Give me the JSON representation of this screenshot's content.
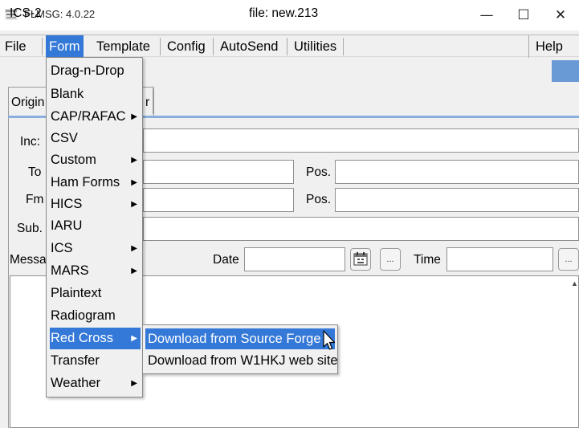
{
  "window": {
    "title": "FLMSG: 4.0.22",
    "controls": {
      "minimize": "—",
      "maximize": "☐",
      "close": "✕"
    }
  },
  "menubar": {
    "items": [
      "File",
      "Form",
      "Template",
      "Config",
      "AutoSend",
      "Utilities"
    ],
    "help": "Help"
  },
  "form_row": {
    "ics_label": "ICS-2",
    "file_label": "file: new.213"
  },
  "tabs": {
    "origin": "Origin",
    "other": "r"
  },
  "fields": {
    "inc_label": "Inc:",
    "to_label": "To",
    "fm_label": "Fm",
    "sub_label": "Sub.",
    "pos_label": "Pos.",
    "message_label": "Messa",
    "date_label": "Date",
    "time_label": "Time",
    "date_value": "",
    "time_value": "",
    "ellipsis": "..."
  },
  "form_menu": {
    "items": [
      {
        "label": "Drag-n-Drop",
        "submenu": false
      },
      {
        "label": "Blank",
        "submenu": false
      },
      {
        "label": "CAP/RAFAC",
        "submenu": true
      },
      {
        "label": "CSV",
        "submenu": false
      },
      {
        "label": "Custom",
        "submenu": true
      },
      {
        "label": "Ham Forms",
        "submenu": true
      },
      {
        "label": "HICS",
        "submenu": true
      },
      {
        "label": "IARU",
        "submenu": false
      },
      {
        "label": "ICS",
        "submenu": true
      },
      {
        "label": "MARS",
        "submenu": true
      },
      {
        "label": "Plaintext",
        "submenu": false
      },
      {
        "label": "Radiogram",
        "submenu": false
      },
      {
        "label": "Red Cross",
        "submenu": true,
        "selected": true
      },
      {
        "label": "Transfer",
        "submenu": false
      },
      {
        "label": "Weather",
        "submenu": true
      }
    ]
  },
  "red_cross_submenu": {
    "items": [
      {
        "label": "Download from Source Forge",
        "selected": true
      },
      {
        "label": "Download from W1HKJ web site"
      }
    ]
  },
  "colors": {
    "highlight": "#3478d8",
    "tab_underline": "#8aaedc",
    "blue_box": "#6a9ad6"
  }
}
